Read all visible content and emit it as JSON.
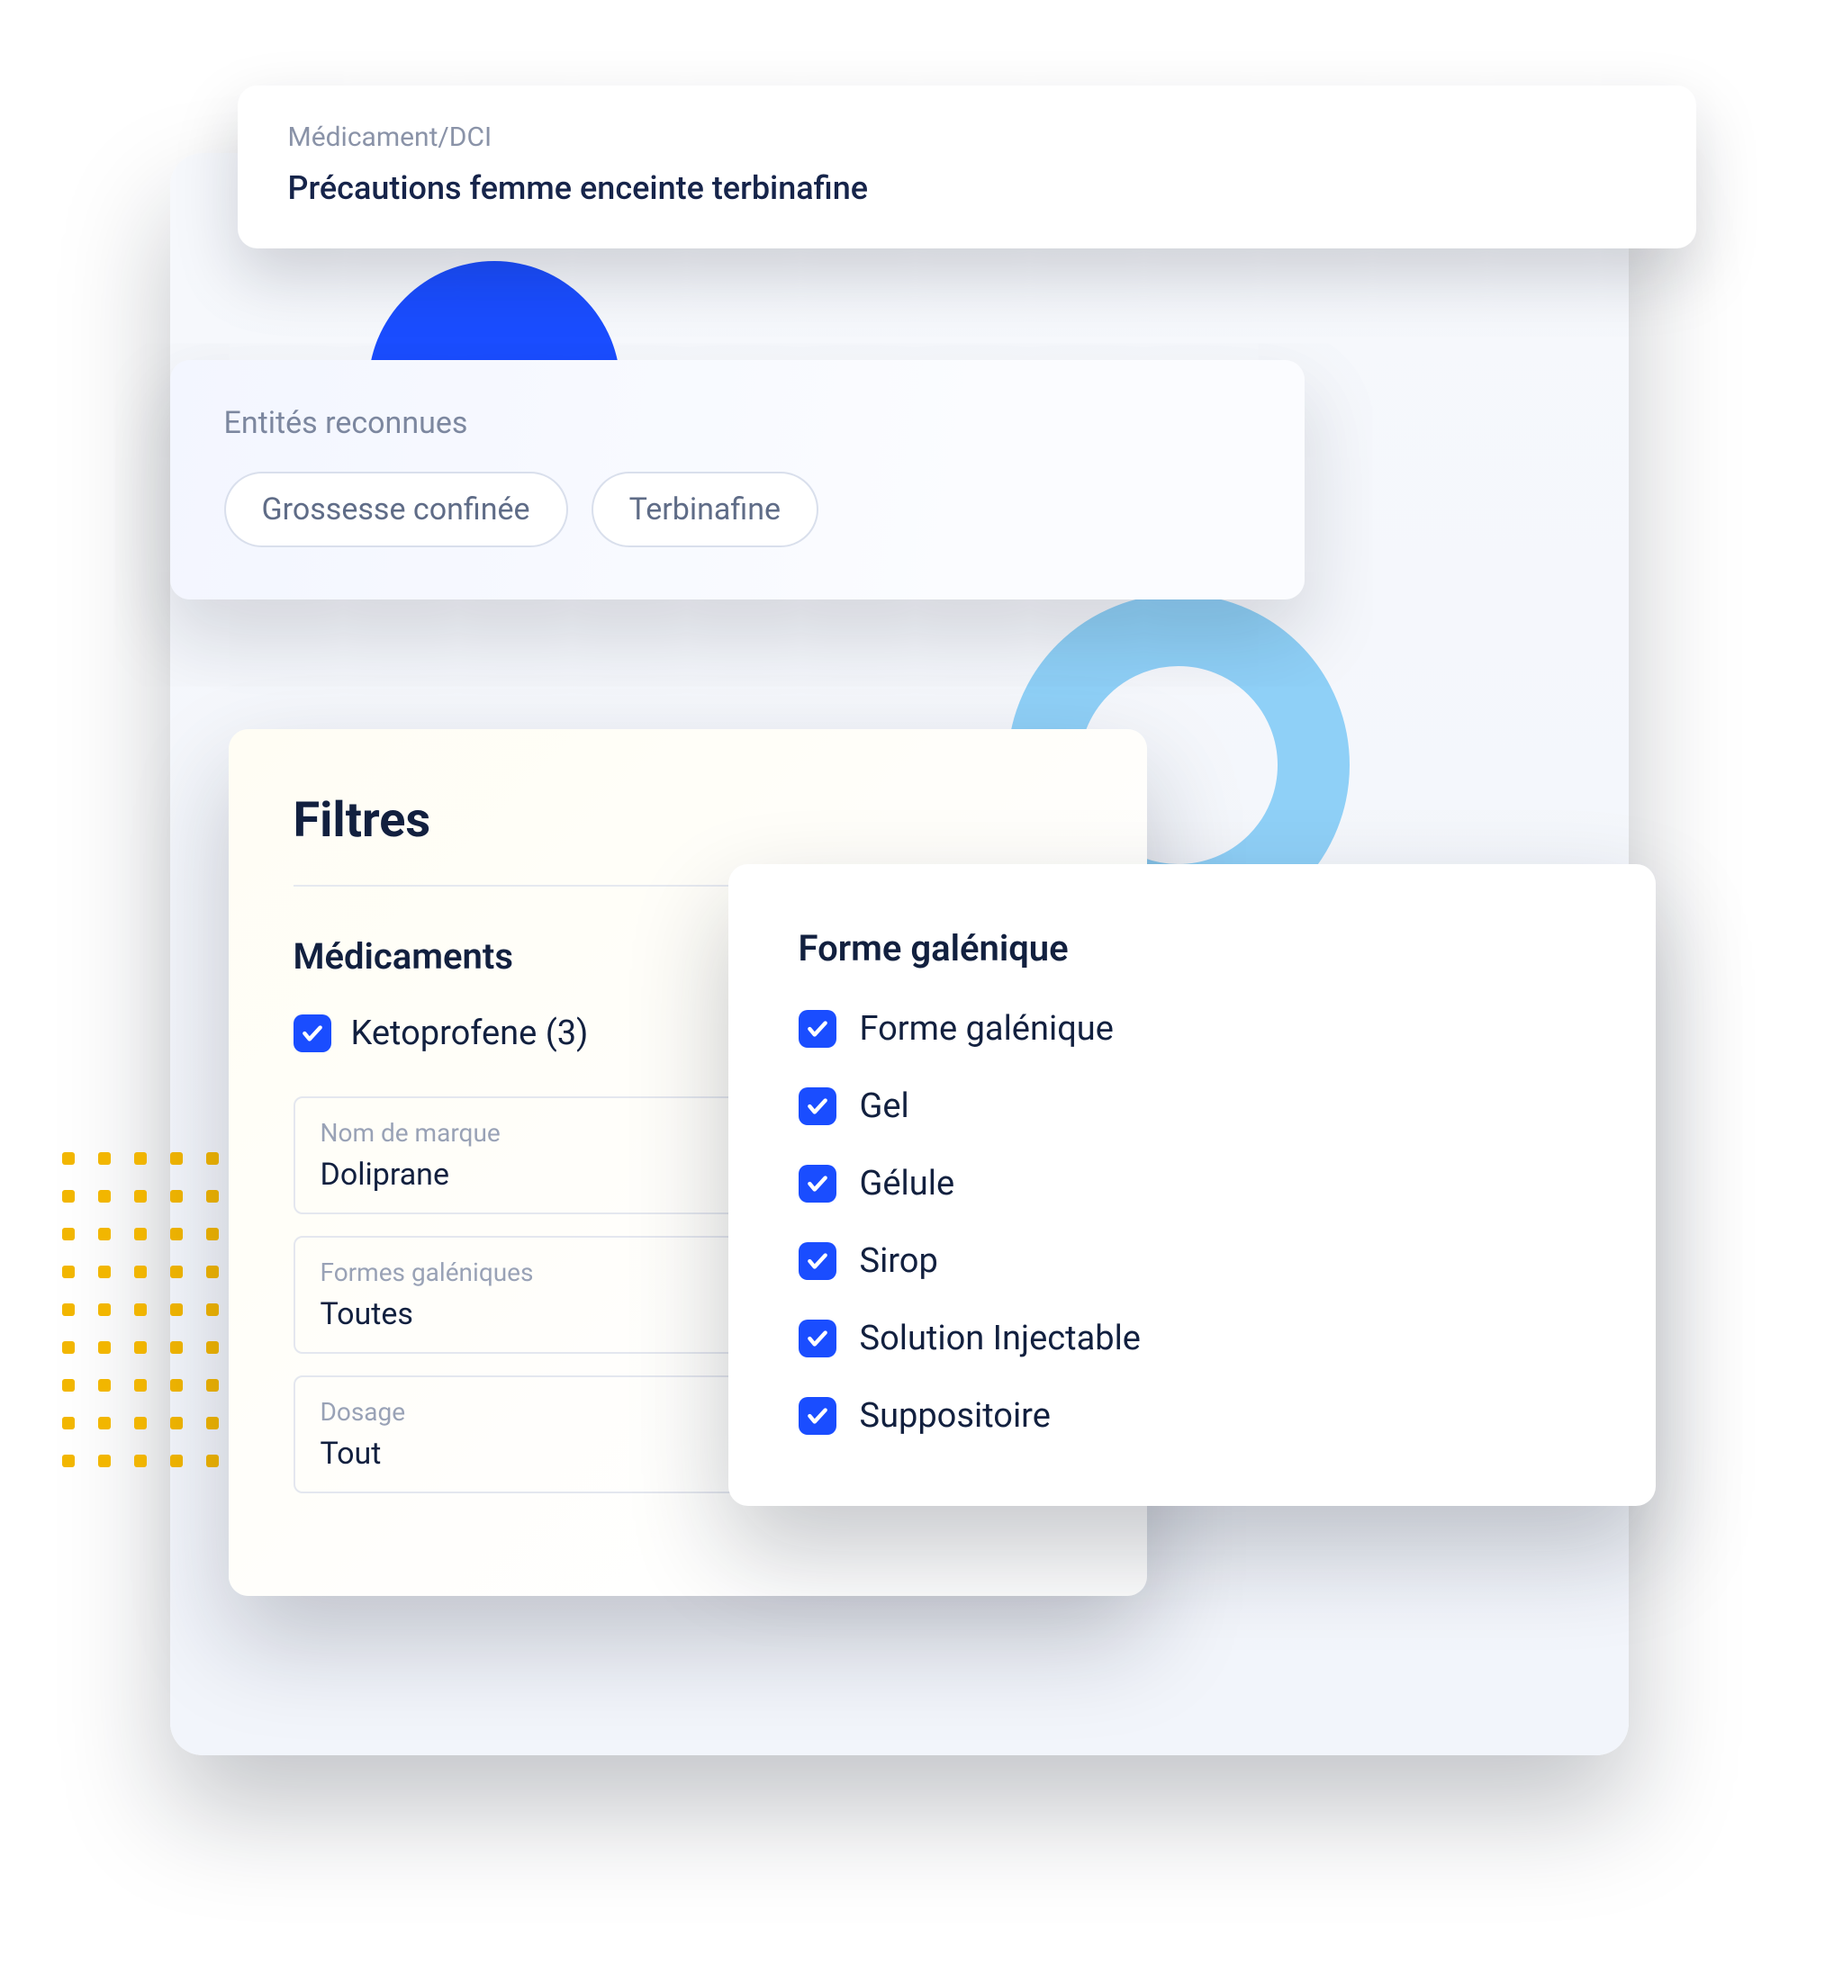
{
  "search": {
    "label": "Médicament/DCI",
    "value": "Précautions femme enceinte terbinafine"
  },
  "entities": {
    "title": "Entités reconnues",
    "items": [
      "Grossesse confinée",
      "Terbinafine"
    ]
  },
  "filters": {
    "heading": "Filtres",
    "meds_heading": "Médicaments",
    "med_item": "Ketoprofene (3)",
    "fields": [
      {
        "label": "Nom de marque",
        "value": "Doliprane"
      },
      {
        "label": "Formes galéniques",
        "value": "Toutes"
      },
      {
        "label": "Dosage",
        "value": "Tout"
      }
    ]
  },
  "forme": {
    "heading": "Forme galénique",
    "items": [
      "Forme galénique",
      "Gel",
      "Gélule",
      "Sirop",
      "Solution Injectable",
      "Suppositoire"
    ]
  },
  "colors": {
    "accent": "#1a4dff",
    "text": "#12203f",
    "muted": "#8a93a8"
  }
}
